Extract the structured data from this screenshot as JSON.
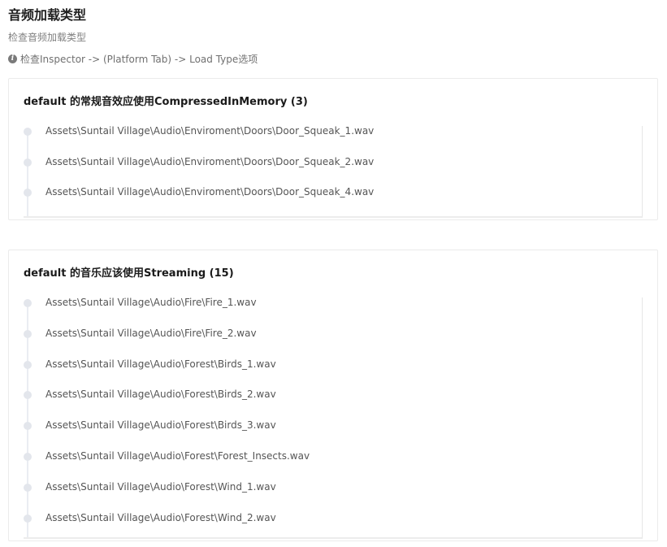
{
  "page": {
    "title": "音频加载类型",
    "subtitle": "检查音频加载类型",
    "hint_icon": "info-icon",
    "hint": "检查Inspector -> (Platform Tab) -> Load Type选项"
  },
  "sections": [
    {
      "title": "default 的常规音效应使用CompressedInMemory (3)",
      "items": [
        "Assets\\Suntail Village\\Audio\\Enviroment\\Doors\\Door_Squeak_1.wav",
        "Assets\\Suntail Village\\Audio\\Enviroment\\Doors\\Door_Squeak_2.wav",
        "Assets\\Suntail Village\\Audio\\Enviroment\\Doors\\Door_Squeak_4.wav"
      ]
    },
    {
      "title": "default 的音乐应该使用Streaming (15)",
      "items": [
        "Assets\\Suntail Village\\Audio\\Fire\\Fire_1.wav",
        "Assets\\Suntail Village\\Audio\\Fire\\Fire_2.wav",
        "Assets\\Suntail Village\\Audio\\Forest\\Birds_1.wav",
        "Assets\\Suntail Village\\Audio\\Forest\\Birds_2.wav",
        "Assets\\Suntail Village\\Audio\\Forest\\Birds_3.wav",
        "Assets\\Suntail Village\\Audio\\Forest\\Forest_Insects.wav",
        "Assets\\Suntail Village\\Audio\\Forest\\Wind_1.wav",
        "Assets\\Suntail Village\\Audio\\Forest\\Wind_2.wav"
      ]
    }
  ],
  "colors": {
    "dot": "#e3e6ec",
    "line": "#eaedf2",
    "card_border": "#ebebeb"
  }
}
